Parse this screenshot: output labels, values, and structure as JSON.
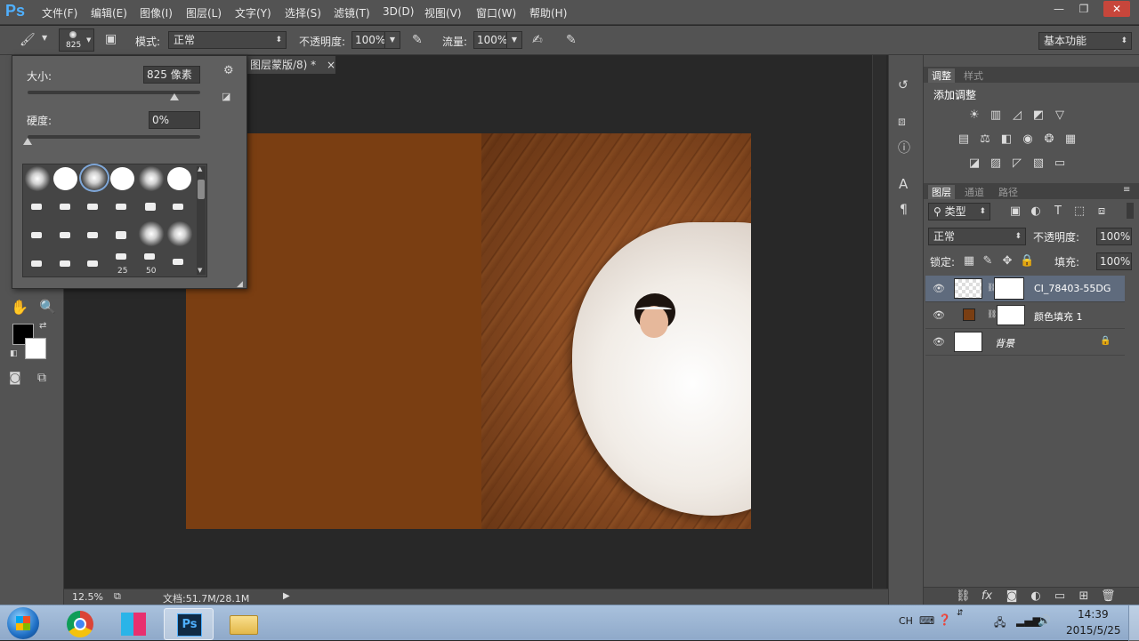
{
  "app": {
    "logo": "Ps"
  },
  "menu": {
    "items": [
      "文件(F)",
      "编辑(E)",
      "图像(I)",
      "图层(L)",
      "文字(Y)",
      "选择(S)",
      "滤镜(T)",
      "3D(D)",
      "视图(V)",
      "窗口(W)",
      "帮助(H)"
    ],
    "window_controls": {
      "minimize": "—",
      "restore": "❐",
      "close": "✕"
    }
  },
  "options_bar": {
    "brush_size": "825",
    "mode_label": "模式:",
    "mode_value": "正常",
    "opacity_label": "不透明度:",
    "opacity_value": "100%",
    "flow_label": "流量:",
    "flow_value": "100%",
    "workspace": "基本功能"
  },
  "brush_popup": {
    "size_label": "大小:",
    "size_value": "825 像素",
    "size_fraction": 0.85,
    "hardness_label": "硬度:",
    "hardness_value": "0%",
    "hardness_fraction": 0.0,
    "preset_numbers": [
      "25",
      "50"
    ]
  },
  "document": {
    "tab_title": "图层蒙版/8) *",
    "tab_close": "×",
    "zoom": "12.5%",
    "doc_info": "文档:51.7M/28.1M",
    "fill_color": "#7a3e12"
  },
  "adjustments_panel": {
    "tabs": [
      "调整",
      "样式"
    ],
    "heading": "添加调整",
    "icons": [
      "brightness-icon",
      "levels-icon",
      "curves-icon",
      "exposure-icon",
      "vibrance-icon",
      "hue-icon",
      "color-balance-icon",
      "bw-icon",
      "photo-filter-icon",
      "channel-mixer-icon",
      "color-lookup-icon",
      "invert-icon",
      "posterize-icon",
      "threshold-icon",
      "gradient-map-icon",
      "selective-color-icon"
    ]
  },
  "layers_panel": {
    "tabs": [
      "图层",
      "通道",
      "路径"
    ],
    "filter_label": "类型",
    "blend_mode": "正常",
    "opacity_label": "不透明度:",
    "opacity_value": "100%",
    "lock_label": "锁定:",
    "fill_label": "填充:",
    "fill_value": "100%",
    "layers": [
      {
        "name": "CI_78403-55DG",
        "selected": true
      },
      {
        "name": "颜色填充 1",
        "selected": false,
        "swatch": "#7a3e12"
      },
      {
        "name": "背景",
        "selected": false,
        "locked": true
      }
    ]
  },
  "taskbar": {
    "lang": "CH",
    "time": "14:39",
    "date": "2015/5/25"
  }
}
